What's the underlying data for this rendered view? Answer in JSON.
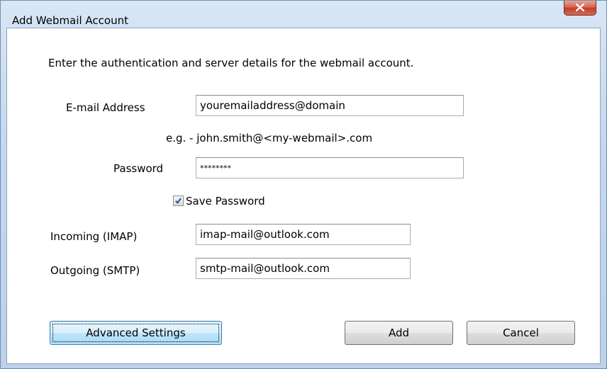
{
  "window": {
    "title": "Add Webmail Account"
  },
  "form": {
    "instructions": "Enter the authentication and server details for the webmail account.",
    "email_label": "E-mail Address",
    "email_value": "youremailaddress@domain",
    "email_hint": "e.g. - john.smith@<my-webmail>.com",
    "password_label": "Password",
    "password_value": "********",
    "save_password_label": "Save Password",
    "save_password_checked": true,
    "incoming_label": "Incoming (IMAP)",
    "incoming_value": "imap-mail@outlook.com",
    "outgoing_label": "Outgoing (SMTP)",
    "outgoing_value": "smtp-mail@outlook.com"
  },
  "buttons": {
    "advanced": "Advanced Settings",
    "add": "Add",
    "cancel": "Cancel"
  },
  "colors": {
    "close_button": "#c0402a",
    "default_button_border": "#3c7fb1"
  }
}
